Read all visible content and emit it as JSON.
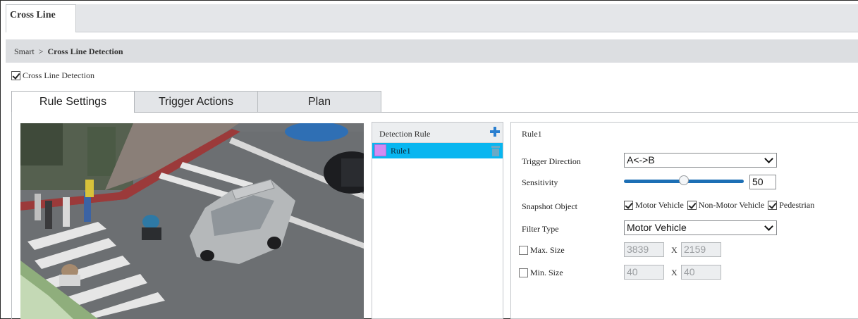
{
  "top_tab": {
    "label": "Cross Line"
  },
  "breadcrumb": {
    "parent": "Smart",
    "separator": ">",
    "current": "Cross Line Detection"
  },
  "enable": {
    "label": "Cross Line Detection",
    "checked": true
  },
  "tabs": [
    {
      "label": "Rule Settings",
      "active": true
    },
    {
      "label": "Trigger Actions",
      "active": false
    },
    {
      "label": "Plan",
      "active": false
    }
  ],
  "rule_list": {
    "header": "Detection Rule",
    "items": [
      {
        "label": "Rule1",
        "color": "#d38bf2",
        "selected": true
      }
    ]
  },
  "settings": {
    "rule_name": "Rule1",
    "trigger_direction": {
      "label": "Trigger Direction",
      "value": "A<->B"
    },
    "sensitivity": {
      "label": "Sensitivity",
      "value": "50",
      "min": 0,
      "max": 100
    },
    "snapshot": {
      "label": "Snapshot Object",
      "options": [
        {
          "label": "Motor Vehicle",
          "checked": true
        },
        {
          "label": "Non-Motor Vehicle",
          "checked": true
        },
        {
          "label": "Pedestrian",
          "checked": true
        }
      ]
    },
    "filter_type": {
      "label": "Filter Type",
      "value": "Motor Vehicle"
    },
    "max_size": {
      "label": "Max. Size",
      "checked": false,
      "width": "3839",
      "height": "2159",
      "x": "X"
    },
    "min_size": {
      "label": "Min. Size",
      "checked": false,
      "width": "40",
      "height": "40",
      "x": "X"
    }
  },
  "colors": {
    "accent": "#09b6f0",
    "slider": "#1d6fb5",
    "add": "#2a7fd0"
  }
}
